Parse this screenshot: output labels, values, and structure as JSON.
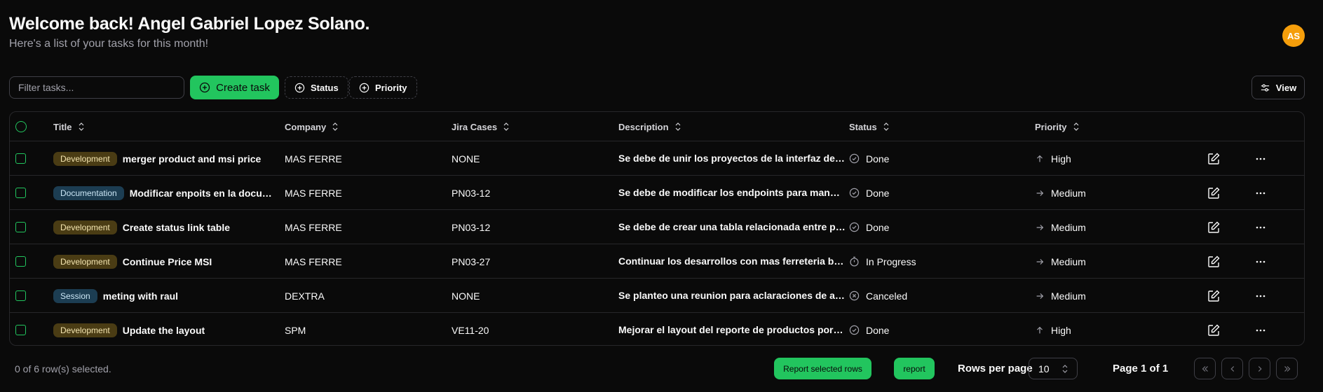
{
  "header": {
    "title": "Welcome back! Angel Gabriel Lopez Solano.",
    "subtitle": "Here's a list of your tasks for this month!",
    "avatar_initials": "AS",
    "avatar_color": "#f59e0b"
  },
  "toolbar": {
    "filter_placeholder": "Filter tasks...",
    "filter_value": "",
    "create_label": "Create task",
    "status_label": "Status",
    "priority_label": "Priority",
    "view_label": "View"
  },
  "columns": {
    "title": "Title",
    "company": "Company",
    "jira": "Jira Cases",
    "description": "Description",
    "status": "Status",
    "priority": "Priority"
  },
  "rows": [
    {
      "label": "Development",
      "title": "merger product and msi price",
      "company": "MAS FERRE",
      "jira": "NONE",
      "description": "Se debe de unir los proyectos de la interfaz de precios",
      "status": "Done",
      "status_icon": "check-circle-icon",
      "priority": "High",
      "priority_icon": "arrow-up-icon"
    },
    {
      "label": "Documentation",
      "title": "Modificar enpoits en la documentacion",
      "company": "MAS FERRE",
      "jira": "PN03-12",
      "description": "Se debe de modificar los endpoints para mandar la informacion",
      "status": "Done",
      "status_icon": "check-circle-icon",
      "priority": "Medium",
      "priority_icon": "arrow-right-icon"
    },
    {
      "label": "Development",
      "title": "Create status link table",
      "company": "MAS FERRE",
      "jira": "PN03-12",
      "description": "Se debe de crear una tabla relacionada entre productos",
      "status": "Done",
      "status_icon": "check-circle-icon",
      "priority": "Medium",
      "priority_icon": "arrow-right-icon"
    },
    {
      "label": "Development",
      "title": "Continue Price MSI",
      "company": "MAS FERRE",
      "jira": "PN03-27",
      "description": "Continuar los desarrollos con mas ferreteria basados en msi",
      "status": "In Progress",
      "status_icon": "stopwatch-icon",
      "priority": "Medium",
      "priority_icon": "arrow-right-icon"
    },
    {
      "label": "Session",
      "title": "meting with raul",
      "company": "DEXTRA",
      "jira": "NONE",
      "description": "Se planteo una reunion para aclaraciones de alcance",
      "status": "Canceled",
      "status_icon": "x-circle-icon",
      "priority": "Medium",
      "priority_icon": "arrow-right-icon"
    },
    {
      "label": "Development",
      "title": "Update the layout",
      "company": "SPM",
      "jira": "VE11-20",
      "description": "Mejorar el layout del reporte de productos por categoria",
      "status": "Done",
      "status_icon": "check-circle-icon",
      "priority": "High",
      "priority_icon": "arrow-up-icon"
    }
  ],
  "footer": {
    "selection_text": "0 of 6 row(s) selected.",
    "report_selected_label": "Report selected rows",
    "report_label": "report",
    "rows_per_page_label": "Rows per page",
    "rows_per_page_value": "10",
    "page_label": "Page 1 of 1"
  },
  "colors": {
    "accent": "#22c55e",
    "background": "#0a0a0a",
    "border": "#27272a"
  }
}
